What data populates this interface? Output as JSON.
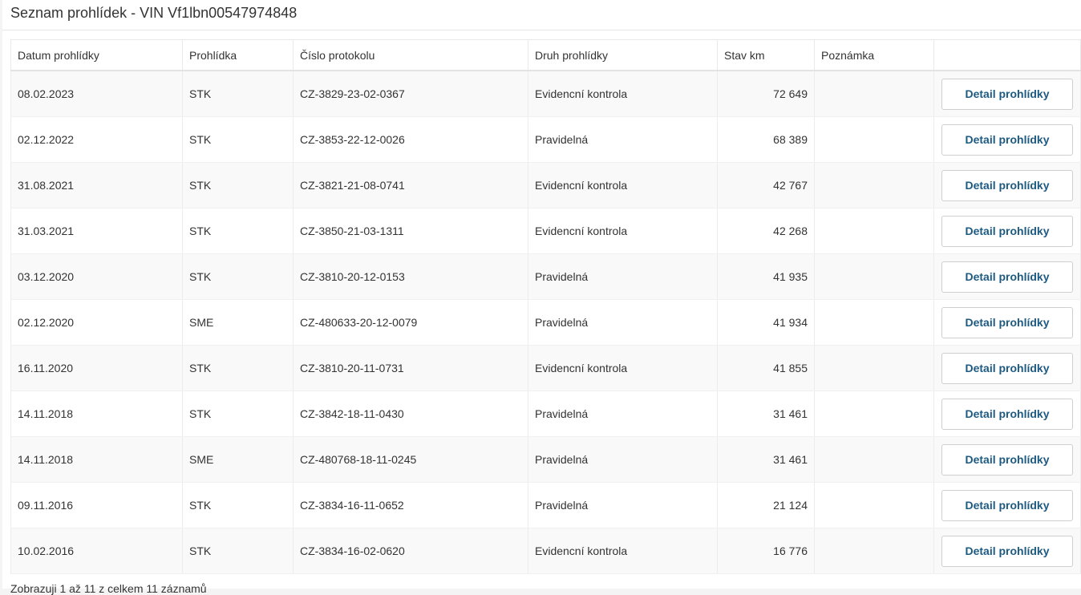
{
  "page": {
    "title": "Seznam prohlídek - VIN Vf1lbn00547974848"
  },
  "table": {
    "columns": [
      {
        "key": "datum",
        "label": "Datum prohlídky"
      },
      {
        "key": "prohlidka",
        "label": "Prohlídka"
      },
      {
        "key": "protokol",
        "label": "Číslo protokolu"
      },
      {
        "key": "druh",
        "label": "Druh prohlídky"
      },
      {
        "key": "km",
        "label": "Stav km"
      },
      {
        "key": "poznamka",
        "label": "Poznámka"
      },
      {
        "key": "akce",
        "label": ""
      }
    ],
    "action_label": "Detail prohlídky",
    "rows": [
      {
        "datum": "08.02.2023",
        "prohlidka": "STK",
        "protokol": "CZ-3829-23-02-0367",
        "druh": "Evidencní kontrola",
        "km": "72 649",
        "poznamka": ""
      },
      {
        "datum": "02.12.2022",
        "prohlidka": "STK",
        "protokol": "CZ-3853-22-12-0026",
        "druh": "Pravidelná",
        "km": "68 389",
        "poznamka": ""
      },
      {
        "datum": "31.08.2021",
        "prohlidka": "STK",
        "protokol": "CZ-3821-21-08-0741",
        "druh": "Evidencní kontrola",
        "km": "42 767",
        "poznamka": ""
      },
      {
        "datum": "31.03.2021",
        "prohlidka": "STK",
        "protokol": "CZ-3850-21-03-1311",
        "druh": "Evidencní kontrola",
        "km": "42 268",
        "poznamka": ""
      },
      {
        "datum": "03.12.2020",
        "prohlidka": "STK",
        "protokol": "CZ-3810-20-12-0153",
        "druh": "Pravidelná",
        "km": "41 935",
        "poznamka": ""
      },
      {
        "datum": "02.12.2020",
        "prohlidka": "SME",
        "protokol": "CZ-480633-20-12-0079",
        "druh": "Pravidelná",
        "km": "41 934",
        "poznamka": ""
      },
      {
        "datum": "16.11.2020",
        "prohlidka": "STK",
        "protokol": "CZ-3810-20-11-0731",
        "druh": "Evidencní kontrola",
        "km": "41 855",
        "poznamka": ""
      },
      {
        "datum": "14.11.2018",
        "prohlidka": "STK",
        "protokol": "CZ-3842-18-11-0430",
        "druh": "Pravidelná",
        "km": "31 461",
        "poznamka": ""
      },
      {
        "datum": "14.11.2018",
        "prohlidka": "SME",
        "protokol": "CZ-480768-18-11-0245",
        "druh": "Pravidelná",
        "km": "31 461",
        "poznamka": ""
      },
      {
        "datum": "09.11.2016",
        "prohlidka": "STK",
        "protokol": "CZ-3834-16-11-0652",
        "druh": "Pravidelná",
        "km": "21 124",
        "poznamka": ""
      },
      {
        "datum": "10.02.2016",
        "prohlidka": "STK",
        "protokol": "CZ-3834-16-02-0620",
        "druh": "Evidencní kontrola",
        "km": "16 776",
        "poznamka": ""
      }
    ]
  },
  "footer": {
    "info": "Zobrazuji 1 až 11 z celkem 11 záznamů"
  },
  "colors": {
    "button_text": "#1d5a82",
    "row_alt": "#f9f9f9"
  }
}
